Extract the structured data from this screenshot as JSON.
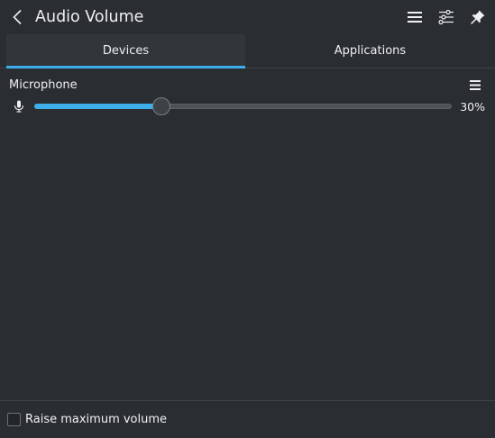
{
  "header": {
    "title": "Audio Volume",
    "icons": {
      "back": "chevron-left-icon",
      "menu": "hamburger-menu-icon",
      "settings": "sliders-icon",
      "pin": "pin-icon"
    }
  },
  "tabs": [
    {
      "label": "Devices",
      "active": true
    },
    {
      "label": "Applications",
      "active": false
    }
  ],
  "device": {
    "name": "Microphone",
    "volume_percent": 30,
    "volume_label": "30%",
    "icons": {
      "type": "microphone-icon",
      "menu": "hamburger-menu-icon"
    }
  },
  "footer": {
    "raise_max_label": "Raise maximum volume",
    "raise_max_checked": false
  },
  "colors": {
    "background": "#2a2e32",
    "accent": "#3daee9",
    "text": "#eff0f1"
  }
}
